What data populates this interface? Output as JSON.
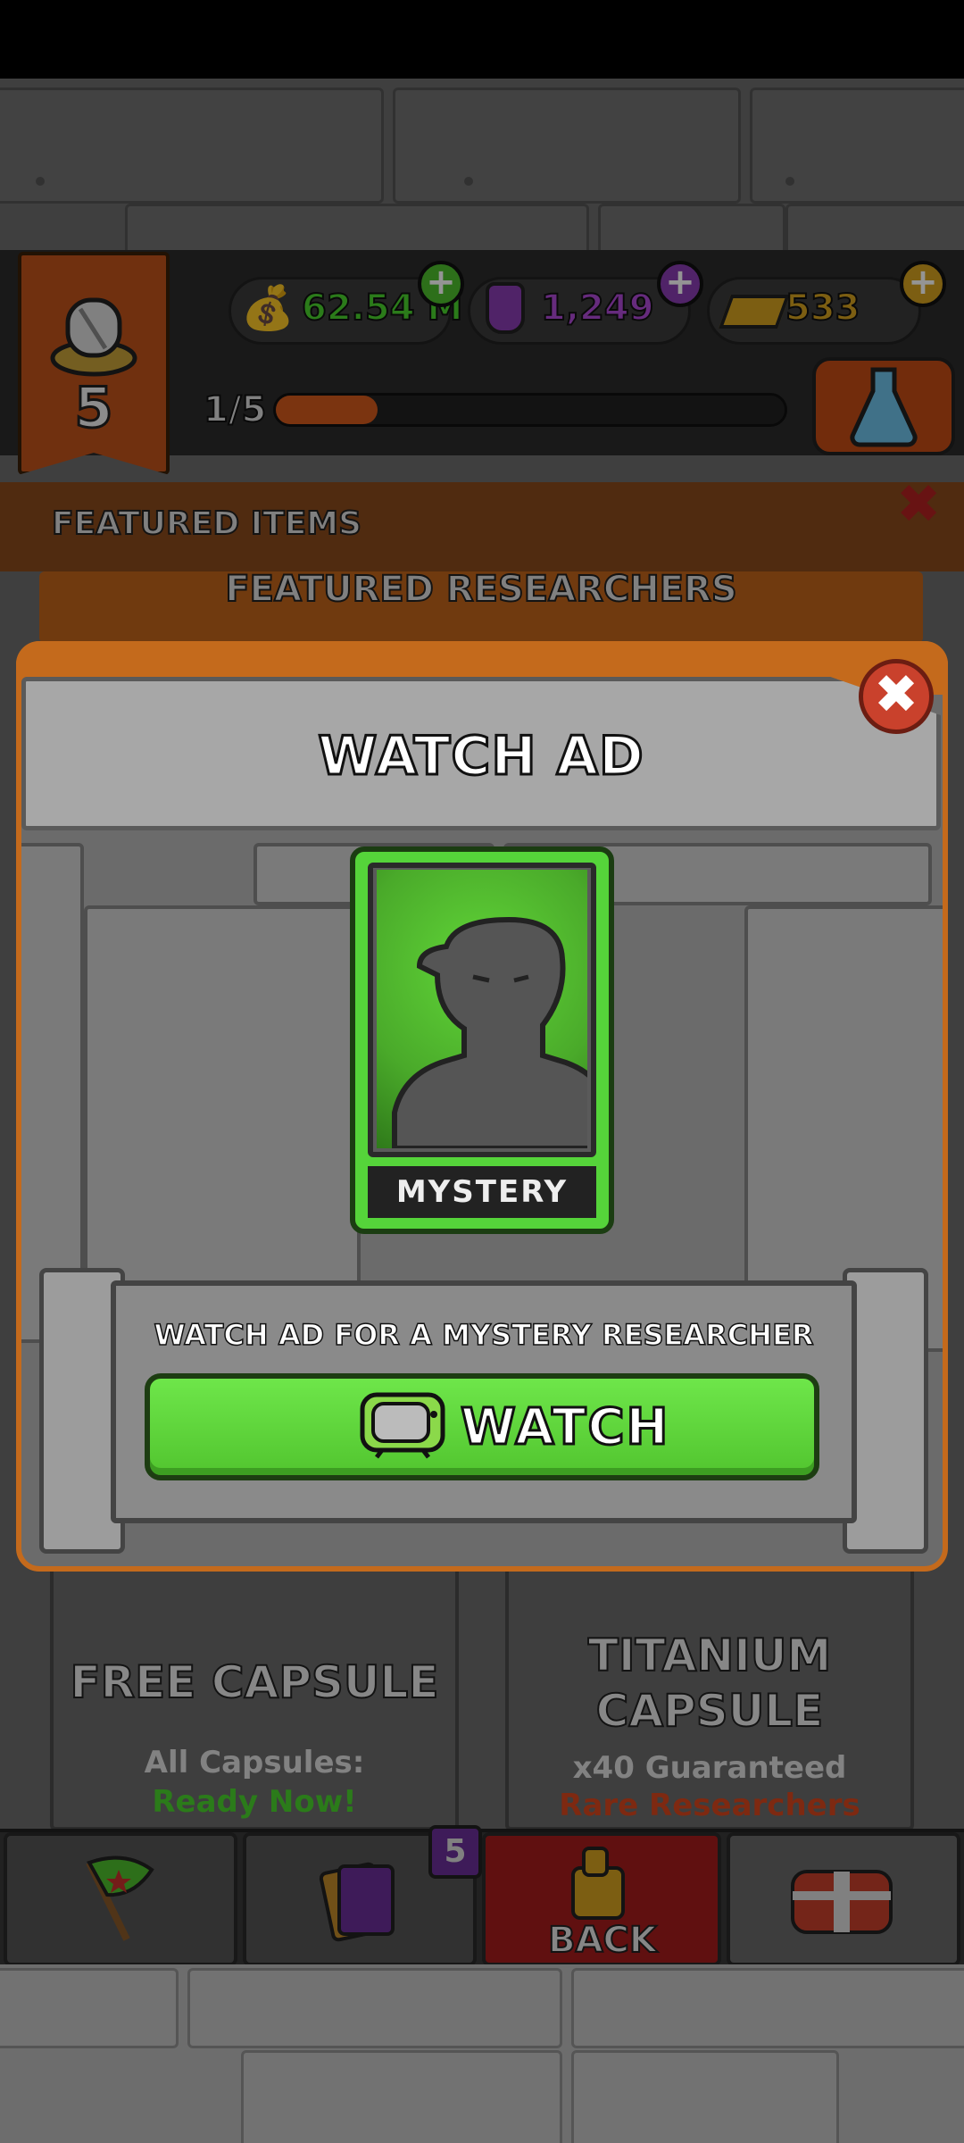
{
  "header": {
    "level": "5",
    "resources": {
      "cash": "62.54 M",
      "potion": "1,249",
      "gold": "533"
    },
    "progress_label": "1/5",
    "progress_fraction": 0.2
  },
  "tabs": {
    "featured_items": "FEATURED ITEMS",
    "featured_researchers": "FEATURED RESEARCHERS"
  },
  "capsules": [
    {
      "title_line1": "FREE CAPSULE",
      "title_line2": "",
      "sub1": "All Capsules:",
      "sub2": "Ready Now!"
    },
    {
      "title_line1": "TITANIUM",
      "title_line2": "CAPSULE",
      "sub1": "x40 Guaranteed",
      "sub2": "Rare Researchers"
    }
  ],
  "bottom_nav": {
    "cards_badge": "5",
    "back_label": "BACK"
  },
  "modal": {
    "title": "WATCH AD",
    "close_glyph": "✖",
    "card_label": "MYSTERY",
    "description": "WATCH AD FOR A MYSTERY RESEARCHER",
    "watch_label": "WATCH"
  },
  "colors": {
    "accent_green": "#55d43a",
    "frame_orange": "#c46a1c",
    "close_red": "#c9412c"
  }
}
